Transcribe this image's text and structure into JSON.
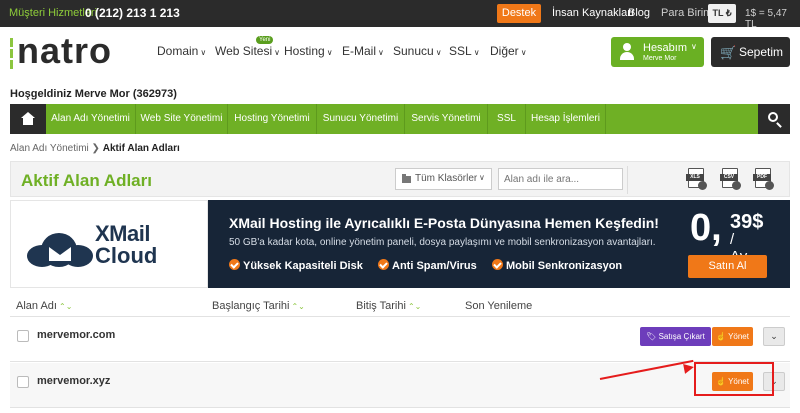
{
  "topbar": {
    "phone_label": "Müşteri Hizmetleri",
    "phone": "0 (212) 213 1 213",
    "support": "Destek",
    "links": [
      "İnsan Kaynakları",
      "Blog"
    ],
    "currency_label": "Para Birimi",
    "currency": "TL",
    "rate": "1$ = 5,47 TL"
  },
  "header": {
    "logo": "natro",
    "nav": [
      {
        "label": "Domain"
      },
      {
        "label": "Web Sitesi",
        "badge": "Yeni"
      },
      {
        "label": "Hosting"
      },
      {
        "label": "E-Mail"
      },
      {
        "label": "Sunucu"
      },
      {
        "label": "SSL"
      },
      {
        "label": "Diğer"
      }
    ],
    "account": {
      "title": "Hesabım",
      "name": "Merve Mor"
    },
    "cart": "Sepetim"
  },
  "welcome": "Hoşgeldiniz Merve Mor (362973)",
  "greennav": {
    "items": [
      "Alan Adı Yönetimi",
      "Web Site Yönetimi",
      "Hosting Yönetimi",
      "Sunucu Yönetimi",
      "Servis Yönetimi",
      "SSL",
      "Hesap İşlemleri"
    ]
  },
  "breadcrumb": {
    "parent": "Alan Adı Yönetimi",
    "current": "Aktif Alan Adları"
  },
  "page": {
    "title": "Aktif Alan Adları",
    "folder_select": "Tüm Klasörler",
    "search_placeholder": "Alan adı ile ara...",
    "exports": [
      "XLS",
      "CSV",
      "PDF"
    ]
  },
  "banner": {
    "logo_top": "XMail",
    "logo_bottom": "Cloud",
    "headline": "XMail Hosting ile Ayrıcalıklı E-Posta Dünyasına Hemen Keşfedin!",
    "subline": "50 GB'a kadar kota, online yönetim paneli, dosya paylaşımı ve mobil senkronizasyon avantajları.",
    "features": [
      "Yüksek Kapasiteli Disk",
      "Anti Spam/Virus",
      "Mobil Senkronizasyon"
    ],
    "price_big": "0,",
    "price_small": "39$",
    "price_per": "/ Ay",
    "buy": "Satın Al"
  },
  "table": {
    "columns": [
      "Alan Adı",
      "Başlangıç Tarihi",
      "Bitiş Tarihi",
      "Son Yenileme"
    ],
    "rows": [
      {
        "domain": "mervemor.com",
        "sell": "Satışa Çıkart",
        "manage": "Yönet"
      },
      {
        "domain": "mervemor.xyz",
        "manage": "Yönet"
      }
    ]
  },
  "colors": {
    "brand_green": "#6fb025",
    "accent_orange": "#f07818",
    "annotation_red": "#e51c1c"
  }
}
